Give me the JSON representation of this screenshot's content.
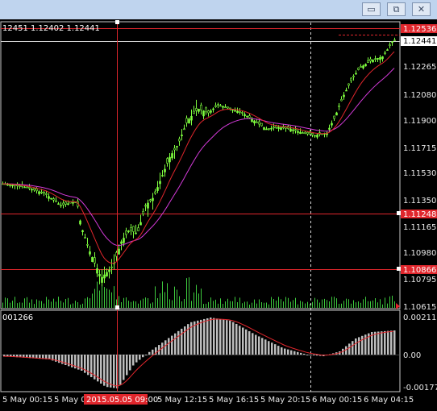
{
  "window": {
    "minimize_glyph": "▭",
    "restore_glyph": "⧉",
    "close_glyph": "✕"
  },
  "ohlc_label": "12451 1.12402 1.12441",
  "price_axis": {
    "ticks": [
      "1.12265",
      "1.12080",
      "1.11900",
      "1.11715",
      "1.11530",
      "1.11350",
      "1.11165",
      "1.10980",
      "1.10795",
      "1.10615"
    ],
    "current_price": "1.12441",
    "highlight_top": "1.12536",
    "level_mid": "1.11248",
    "level_low": "1.10866"
  },
  "macd_axis": {
    "label_left": "001266",
    "top": "0.002119",
    "zero": "0.00",
    "bottom": "-0.00177"
  },
  "time_axis": {
    "labels": [
      "5 May 00:15",
      "5 May 0",
      "5 May 12:15",
      "5 May 16:15",
      "5 May 20:15",
      "6 May 00:15",
      "6 May 04:15"
    ],
    "crosshair_time": "2015.05.05 09:00"
  },
  "colors": {
    "candles": "#7fff3f",
    "ma_fast": "#e0262c",
    "ma_slow": "#d33ad8",
    "volume": "#3ecb3e",
    "macd_hist": "#bdbdbd",
    "macd_signal": "#e0262c",
    "level_line": "#e0262c",
    "crosshair": "#e0262c"
  }
}
